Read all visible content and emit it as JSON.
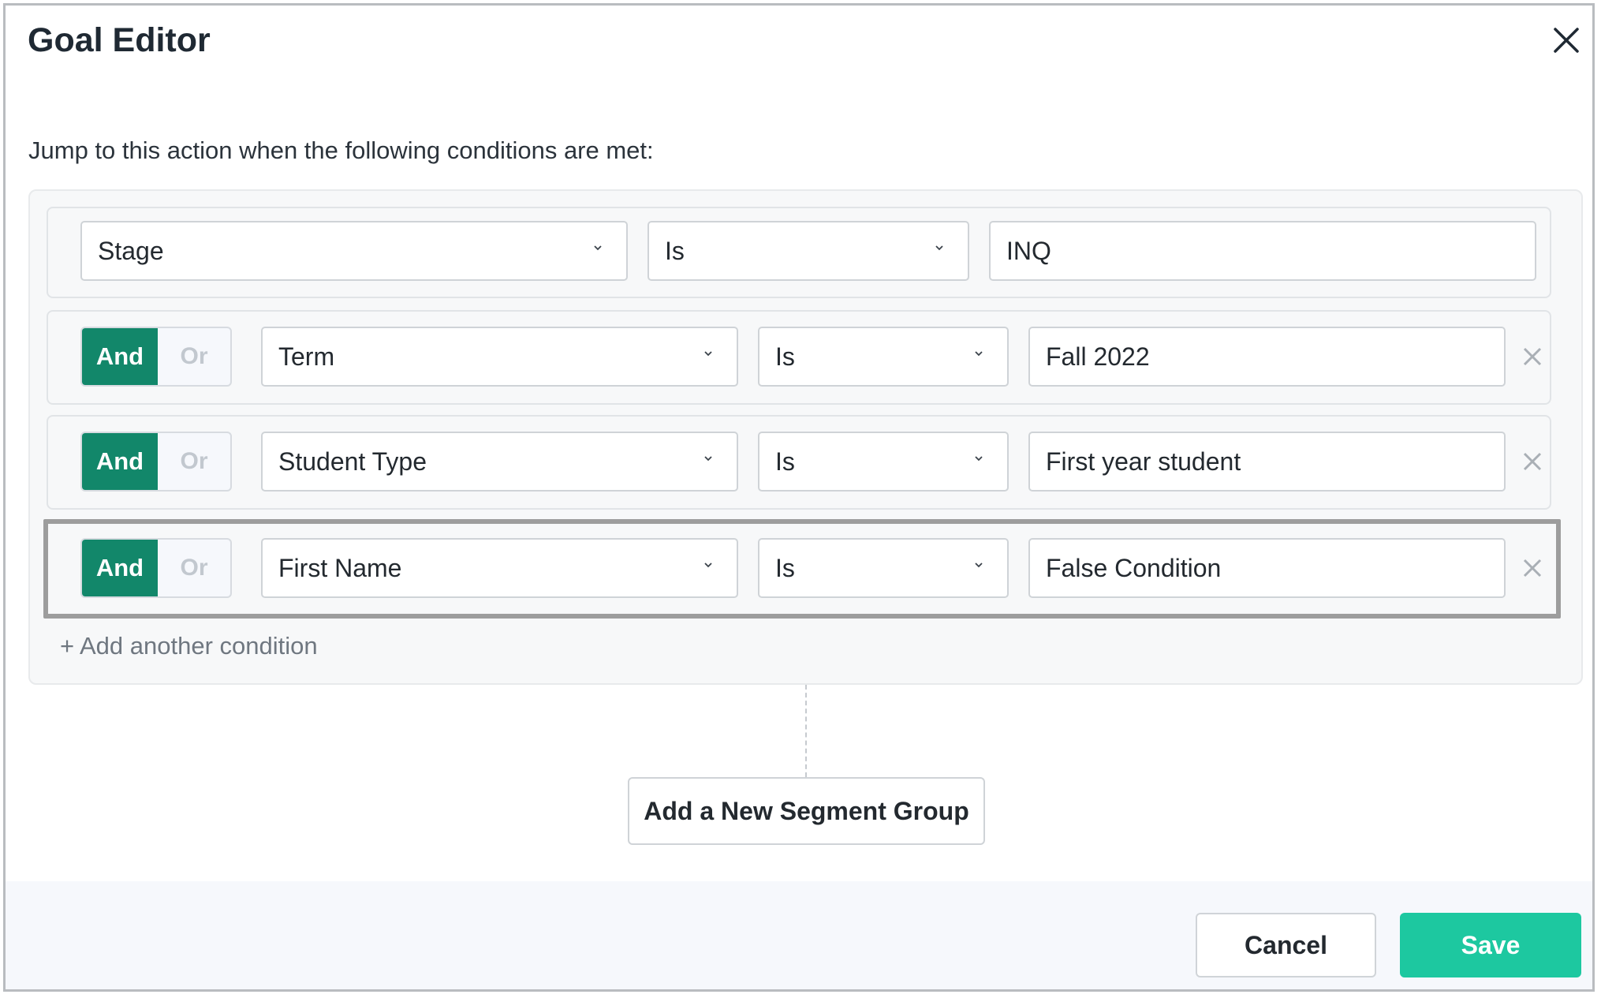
{
  "dialog": {
    "title": "Goal Editor",
    "intro": "Jump to this action when the following conditions are met:"
  },
  "conditions": [
    {
      "field": "Stage",
      "operator": "Is",
      "value": "INQ"
    },
    {
      "connector_and": "And",
      "connector_or": "Or",
      "connector_selected": "And",
      "field": "Term",
      "operator": "Is",
      "value": "Fall 2022"
    },
    {
      "connector_and": "And",
      "connector_or": "Or",
      "connector_selected": "And",
      "field": "Student Type",
      "operator": "Is",
      "value": "First year student"
    },
    {
      "connector_and": "And",
      "connector_or": "Or",
      "connector_selected": "And",
      "field": "First Name",
      "operator": "Is",
      "value": "False Condition"
    }
  ],
  "add_condition": "+ Add another condition",
  "add_segment_group": "Add a New Segment Group",
  "footer": {
    "cancel": "Cancel",
    "save": "Save"
  },
  "colors": {
    "and_active": "#12876a",
    "save": "#1dc8a0",
    "highlight_border": "#9d9d9d"
  },
  "icons": {
    "close": "close-icon",
    "dropdown": "chevron-down-icon",
    "remove": "remove-icon"
  }
}
